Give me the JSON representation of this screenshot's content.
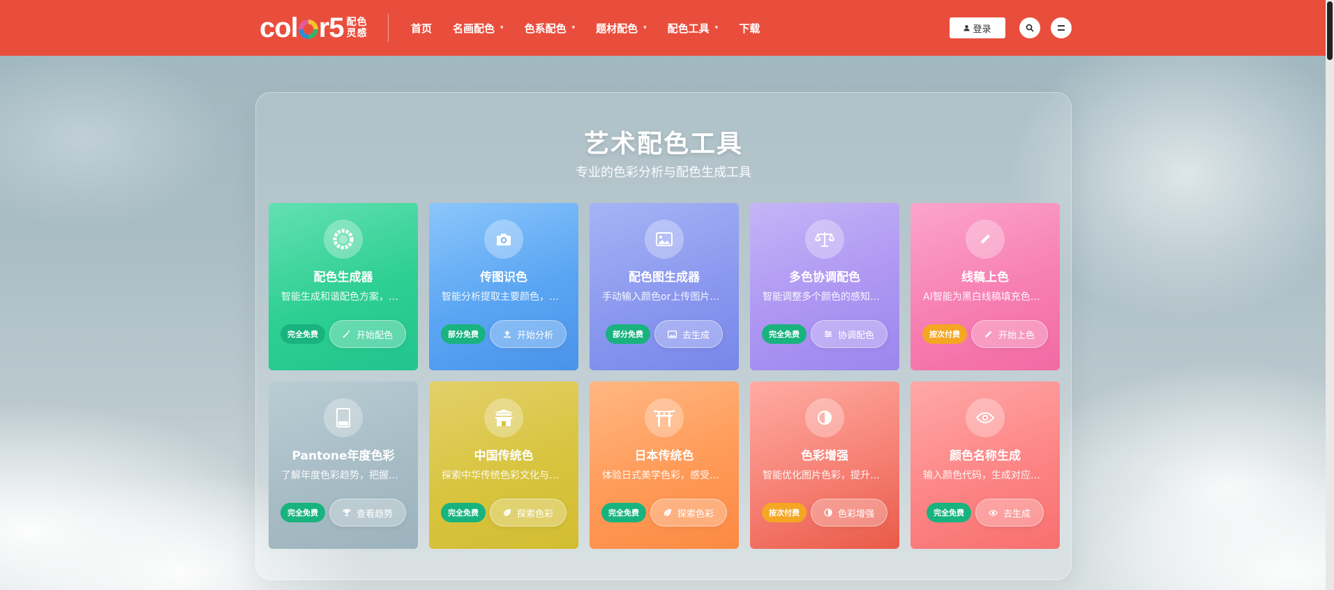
{
  "header": {
    "logo_text_pre": "col",
    "logo_text_post": "r5",
    "logo_sub_1": "配色",
    "logo_sub_2": "灵感",
    "nav": [
      {
        "label": "首页",
        "dropdown": false
      },
      {
        "label": "名画配色",
        "dropdown": true
      },
      {
        "label": "色系配色",
        "dropdown": true
      },
      {
        "label": "题材配色",
        "dropdown": true
      },
      {
        "label": "配色工具",
        "dropdown": true
      },
      {
        "label": "下载",
        "dropdown": false
      }
    ],
    "caret": "⌄",
    "login_label": "登录",
    "accent_color": "#e94e3d"
  },
  "panel": {
    "title": "艺术配色工具",
    "subtitle": "专业的色彩分析与配色生成工具"
  },
  "cards": [
    {
      "title": "配色生成器",
      "desc": "智能生成和谐配色方案，支持多种配色规则",
      "badge": "完全免费",
      "badge_type": "free",
      "action": "开始配色",
      "icon": "color-wheel-icon",
      "action_icon": "magic-wand-icon"
    },
    {
      "title": "传图识色",
      "desc": "智能分析提取主要颜色，一键获取配色",
      "badge": "部分免费",
      "badge_type": "free",
      "action": "开始分析",
      "icon": "camera-icon",
      "action_icon": "upload-icon"
    },
    {
      "title": "配色图生成器",
      "desc": "手动输入颜色or上传图片生成配色图",
      "badge": "部分免费",
      "badge_type": "free",
      "action": "去生成",
      "icon": "image-icon",
      "action_icon": "image-icon"
    },
    {
      "title": "多色协调配色",
      "desc": "智能调整多个颜色的感知亮度与和谐度",
      "badge": "完全免费",
      "badge_type": "free",
      "action": "协调配色",
      "icon": "balance-scale-icon",
      "action_icon": "sliders-icon"
    },
    {
      "title": "线稿上色",
      "desc": "AI智能为黑白线稿填充色彩，一键上色",
      "badge": "按次付费",
      "badge_type": "paid",
      "action": "开始上色",
      "icon": "pencil-icon",
      "action_icon": "pencil-icon"
    },
    {
      "title": "Pantone年度色彩",
      "desc": "了解年度色彩趋势，把握流行配色",
      "badge": "完全免费",
      "badge_type": "free",
      "action": "查看趋势",
      "icon": "pantone-swatch-icon",
      "action_icon": "trophy-icon"
    },
    {
      "title": "中国传统色",
      "desc": "探索中华传统色彩文化与典雅配色",
      "badge": "完全免费",
      "badge_type": "free",
      "action": "探索色彩",
      "icon": "chinese-gate-icon",
      "action_icon": "leaf-icon"
    },
    {
      "title": "日本传统色",
      "desc": "体验日式美学色彩，感受和风之美",
      "badge": "完全免费",
      "badge_type": "free",
      "action": "探索色彩",
      "icon": "torii-gate-icon",
      "action_icon": "leaf-icon"
    },
    {
      "title": "色彩增强",
      "desc": "智能优化图片色彩，提升画面表现力",
      "badge": "按次付费",
      "badge_type": "paid",
      "action": "色彩增强",
      "icon": "contrast-icon",
      "action_icon": "contrast-icon"
    },
    {
      "title": "颜色名称生成",
      "desc": "输入颜色代码，生成对应的颜色名称",
      "badge": "完全免费",
      "badge_type": "free",
      "action": "去生成",
      "icon": "eye-icon",
      "action_icon": "eye-icon"
    }
  ]
}
